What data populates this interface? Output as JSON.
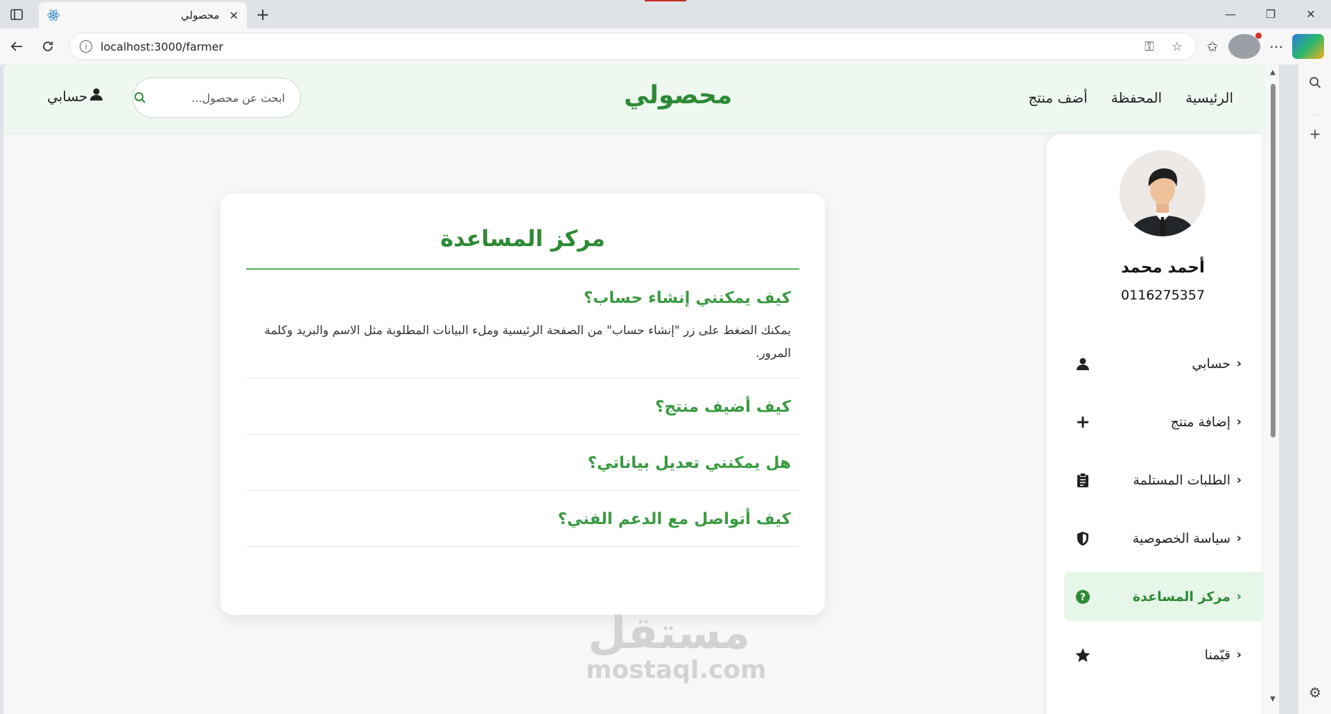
{
  "browser": {
    "tab_title": "محصولي",
    "url": "localhost:3000/farmer",
    "new_tab": "+",
    "tab_close": "✕"
  },
  "header": {
    "brand": "محصولي",
    "nav": [
      "الرئيسية",
      "المحفظة",
      "أضف منتج"
    ],
    "search_placeholder": "ابحث عن محصول...",
    "account_label": "حسابي"
  },
  "help": {
    "title": "مركز المساعدة",
    "faqs": [
      {
        "question": "كيف يمكنني إنشاء حساب؟",
        "answer": "يمكنك الضغط على زر \"إنشاء حساب\" من الصفحة الرئيسية وملء البيانات المطلوبة مثل الاسم والبريد وكلمة المرور."
      },
      {
        "question": "كيف أضيف منتج؟"
      },
      {
        "question": "هل يمكنني تعديل بياناتي؟"
      },
      {
        "question": "كيف أتواصل مع الدعم الفني؟"
      }
    ]
  },
  "profile": {
    "name": "أحمد محمد",
    "phone": "0116275357",
    "menu": [
      {
        "label": "حسابي",
        "icon": "user-icon"
      },
      {
        "label": "إضافة منتج",
        "icon": "plus-icon"
      },
      {
        "label": "الطلبات المستلمة",
        "icon": "clipboard-icon"
      },
      {
        "label": "سياسة الخصوصية",
        "icon": "shield-icon"
      },
      {
        "label": "مركز المساعدة",
        "icon": "question-circle-icon",
        "active": true
      },
      {
        "label": "قيّمنا",
        "icon": "star-icon"
      }
    ]
  },
  "watermark": {
    "arabic": "مستقل",
    "latin": "mostaql.com"
  },
  "colors": {
    "brand_green": "#2d8a34",
    "header_bg": "#eef8f0",
    "active_bg": "#e6f6e8"
  }
}
